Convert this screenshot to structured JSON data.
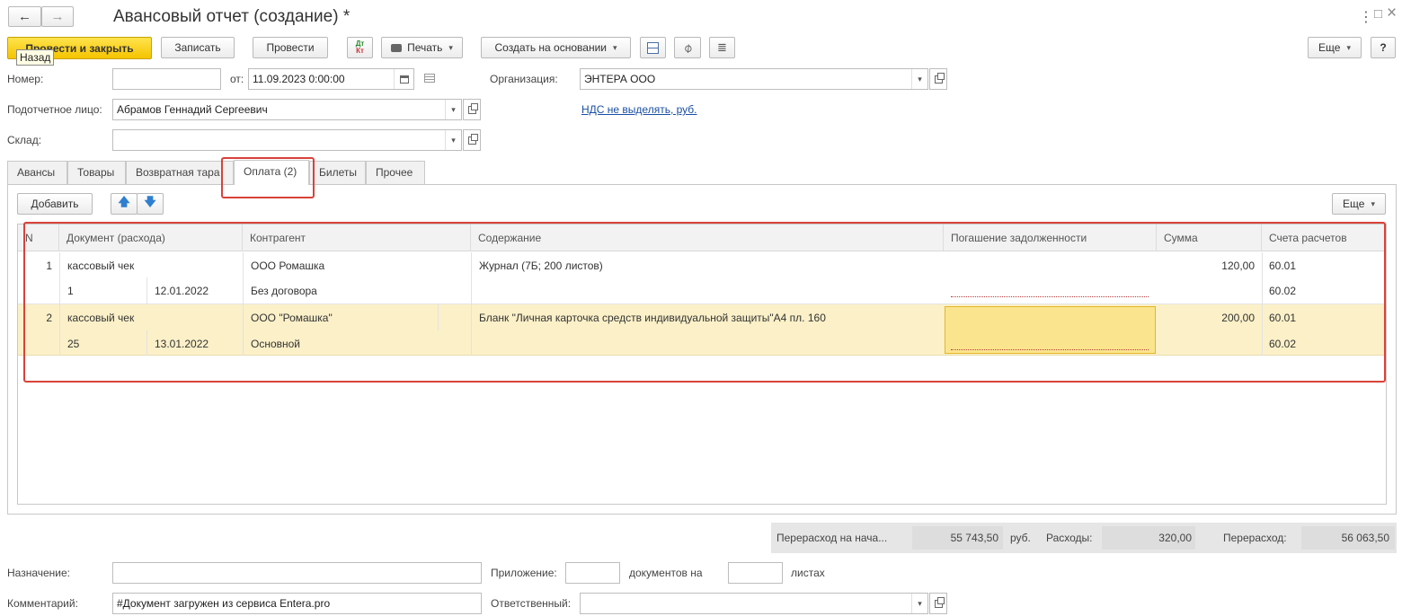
{
  "window": {
    "title": "Авансовый отчет (создание) *",
    "menu_dots": "⋮",
    "fullscreen": "□",
    "close": "×"
  },
  "toolbar": {
    "post_close": "Провести и закрыть",
    "tooltip_back": "Назад",
    "save": "Записать",
    "post": "Провести",
    "dt_kt_top": "Дт",
    "dt_kt_bottom": "Кт",
    "print": "Печать",
    "create_based": "Создать на основании",
    "more": "Еще",
    "help": "?"
  },
  "form": {
    "number_label": "Номер:",
    "number_value": "",
    "date_label": "от:",
    "date_value": "11.09.2023  0:00:00",
    "org_label": "Организация:",
    "org_value": "ЭНТЕРА ООО",
    "person_label": "Подотчетное лицо:",
    "person_value": "Абрамов Геннадий Сергеевич",
    "vat_link": "НДС не выделять, руб.",
    "warehouse_label": "Склад:",
    "warehouse_value": ""
  },
  "tabs": [
    {
      "label": "Авансы"
    },
    {
      "label": "Товары"
    },
    {
      "label": "Возвратная тара"
    },
    {
      "label": "Оплата (2)"
    },
    {
      "label": "Билеты"
    },
    {
      "label": "Прочее"
    }
  ],
  "table_toolbar": {
    "add": "Добавить",
    "more": "Еще"
  },
  "table": {
    "columns": [
      "N",
      "Документ (расхода)",
      "Контрагент",
      "Содержание",
      "Погашение задолженности",
      "Сумма",
      "Счета расчетов"
    ],
    "rows": [
      {
        "n": "1",
        "doc_type": "кассовый чек",
        "doc_no": "1",
        "doc_date": "12.01.2022",
        "counterparty": "ООО Ромашка",
        "contract": "Без договора",
        "content": "Журнал (7Б; 200 листов)",
        "repayment": "",
        "sum": "120,00",
        "acc1": "60.01",
        "acc2": "60.02"
      },
      {
        "n": "2",
        "doc_type": "кассовый чек",
        "doc_no": "25",
        "doc_date": "13.01.2022",
        "counterparty": "ООО \"Ромашка\"",
        "contract": "Основной",
        "content": "Бланк \"Личная карточка средств индивидуальной защиты\"А4 пл. 160",
        "repayment": "",
        "sum": "200,00",
        "acc1": "60.01",
        "acc2": "60.02"
      }
    ]
  },
  "totals": {
    "overspend_start_label": "Перерасход на нача...",
    "overspend_start_value": "55 743,50",
    "currency": "руб.",
    "expenses_label": "Расходы:",
    "expenses_value": "320,00",
    "overspend_label": "Перерасход:",
    "overspend_value": "56 063,50"
  },
  "bottom": {
    "purpose_label": "Назначение:",
    "purpose_value": "",
    "attachment_label": "Приложение:",
    "attachment_value": "",
    "docs_on": "документов на",
    "sheets_value": "",
    "sheets": "листах",
    "comment_label": "Комментарий:",
    "comment_value": "#Документ загружен из сервиса Entera.pro",
    "responsible_label": "Ответственный:",
    "responsible_value": ""
  },
  "colors": {
    "accent_yellow": "#f5c400",
    "selected_row": "#fbf0c8",
    "highlight_red": "#d9423b",
    "link": "#1a4fa3"
  }
}
